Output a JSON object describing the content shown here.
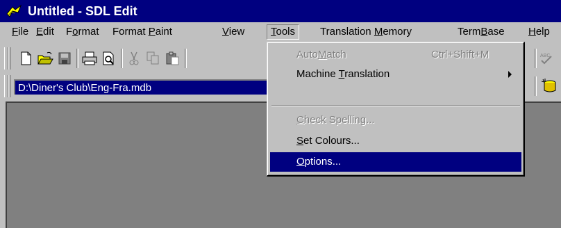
{
  "window": {
    "title": "Untitled - SDL Edit"
  },
  "menubar": {
    "items": [
      {
        "pre": "",
        "acc": "F",
        "post": "ile"
      },
      {
        "pre": "",
        "acc": "E",
        "post": "dit"
      },
      {
        "pre": "F",
        "acc": "o",
        "post": "rmat"
      },
      {
        "pre": "Format ",
        "acc": "P",
        "post": "aint"
      },
      {
        "pre": "",
        "acc": "V",
        "post": "iew"
      },
      {
        "pre": "",
        "acc": "T",
        "post": "ools"
      },
      {
        "pre": "Translation ",
        "acc": "M",
        "post": "emory"
      },
      {
        "pre": "Term",
        "acc": "B",
        "post": "ase"
      },
      {
        "pre": "",
        "acc": "H",
        "post": "elp"
      }
    ]
  },
  "toolbar": {
    "icons": [
      "new-document-icon",
      "open-folder-icon",
      "save-icon",
      "print-icon",
      "print-preview-icon",
      "cut-icon",
      "copy-icon",
      "paste-icon",
      "spellcheck-icon",
      "database-icon"
    ]
  },
  "address": {
    "path": "D:\\Diner's Club\\Eng-Fra.mdb"
  },
  "tools_menu": {
    "automatch": {
      "pre": "Auto",
      "acc": "M",
      "post": "atch",
      "shortcut": "Ctrl+Shift+M",
      "enabled": false
    },
    "machine_translation": {
      "pre": "Machine ",
      "acc": "T",
      "post": "ranslation",
      "has_submenu": true
    },
    "check_spelling": {
      "pre": "",
      "acc": "C",
      "post": "heck Spelling...",
      "enabled": false
    },
    "set_colours": {
      "pre": "",
      "acc": "S",
      "post": "et Colours..."
    },
    "options": {
      "pre": "",
      "acc": "O",
      "post": "ptions...",
      "selected": true
    }
  },
  "colors": {
    "titlebar": "#000080",
    "highlight": "#000080",
    "face": "#c0c0c0",
    "workspace": "#808080"
  }
}
